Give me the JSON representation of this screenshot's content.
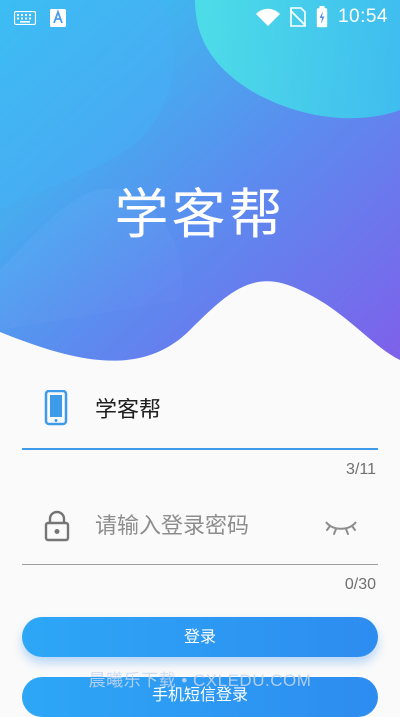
{
  "status_bar": {
    "time": "10:54",
    "icons": [
      "keyboard-icon",
      "font-a-icon",
      "wifi-icon",
      "no-sim-icon",
      "battery-charging-icon"
    ]
  },
  "app": {
    "title": "学客帮"
  },
  "login_form": {
    "phone": {
      "value": "学客帮",
      "counter": "3/11",
      "icon": "phone-icon"
    },
    "password": {
      "placeholder": "请输入登录密码",
      "counter": "0/30",
      "icon": "lock-icon",
      "toggle_icon": "eye-closed-icon"
    },
    "login_button": "登录",
    "sms_login_button": "手机短信登录"
  },
  "watermark": "晨曦乐下载 • CXLEDU.COM",
  "colors": {
    "primary": "#2d9cf0",
    "hero_gradient": [
      "#3ec7f2",
      "#5a8bef",
      "#7a62ea"
    ]
  }
}
